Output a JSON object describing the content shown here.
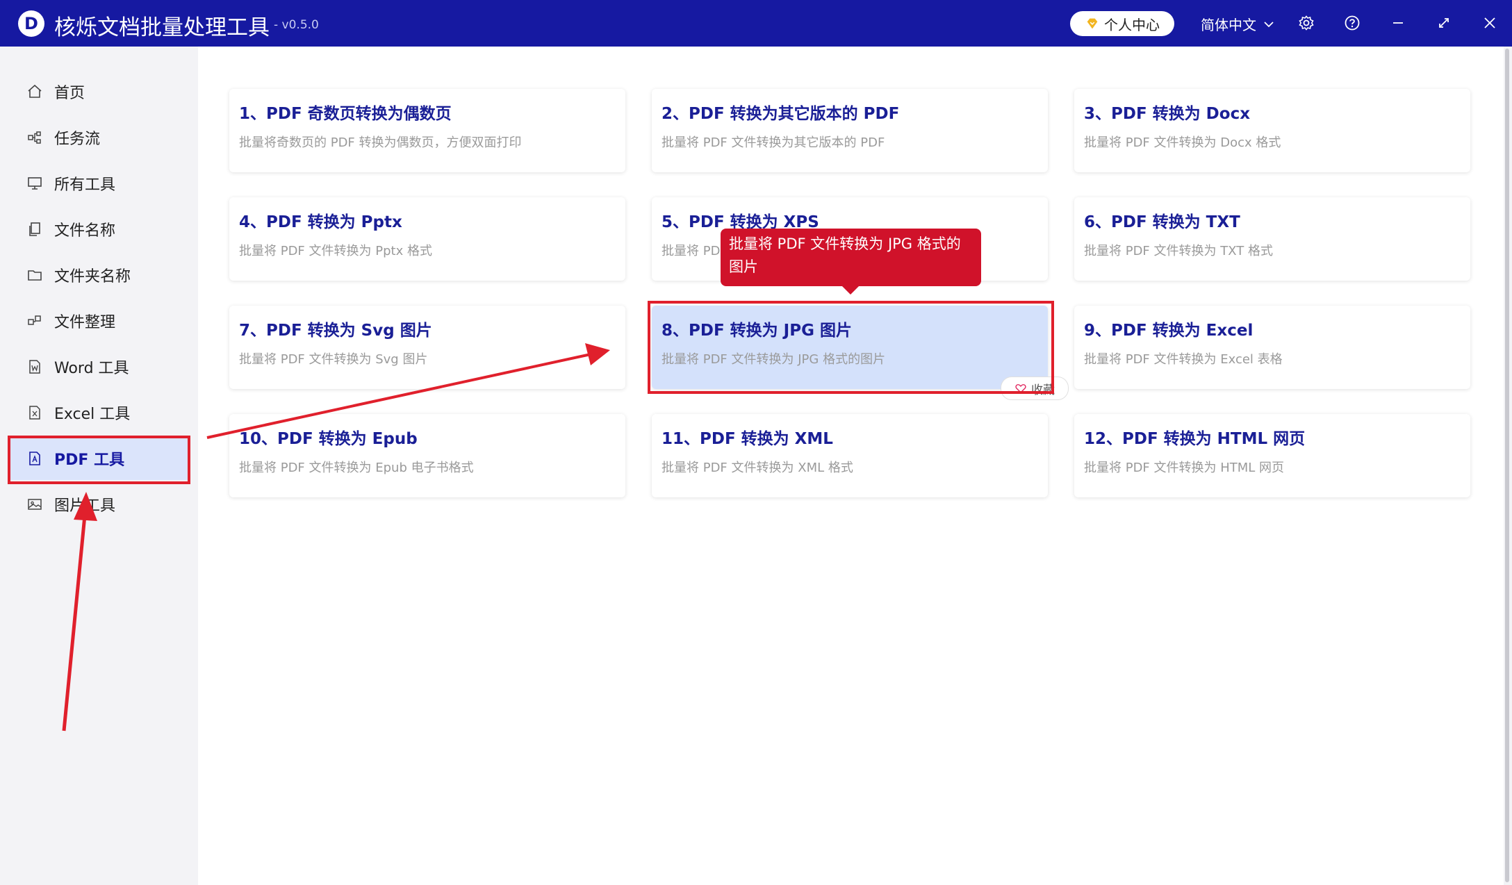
{
  "app": {
    "title": "核烁文档批量处理工具",
    "version": "- v0.5.0",
    "logo_letter": "D",
    "vip_label": "个人中心",
    "language": "简体中文"
  },
  "sidebar": {
    "items": [
      {
        "label": "首页",
        "icon": "home-icon"
      },
      {
        "label": "任务流",
        "icon": "workflow-icon"
      },
      {
        "label": "所有工具",
        "icon": "monitor-icon"
      },
      {
        "label": "文件名称",
        "icon": "file-copy-icon"
      },
      {
        "label": "文件夹名称",
        "icon": "folder-icon"
      },
      {
        "label": "文件整理",
        "icon": "organize-icon"
      },
      {
        "label": "Word 工具",
        "icon": "word-file-icon"
      },
      {
        "label": "Excel 工具",
        "icon": "excel-file-icon"
      },
      {
        "label": "PDF 工具",
        "icon": "pdf-file-icon"
      },
      {
        "label": "图片工具",
        "icon": "image-icon"
      }
    ],
    "active_index": 8
  },
  "tools": [
    {
      "title": "1、PDF 奇数页转换为偶数页",
      "desc": "批量将奇数页的 PDF 转换为偶数页，方便双面打印"
    },
    {
      "title": "2、PDF 转换为其它版本的 PDF",
      "desc": "批量将 PDF 文件转换为其它版本的 PDF"
    },
    {
      "title": "3、PDF 转换为 Docx",
      "desc": "批量将 PDF 文件转换为 Docx 格式"
    },
    {
      "title": "4、PDF 转换为 Pptx",
      "desc": "批量将 PDF 文件转换为 Pptx 格式"
    },
    {
      "title": "5、PDF 转换为 XPS",
      "desc": "批量将 PDF 文件转换为 XPS 格式"
    },
    {
      "title": "6、PDF 转换为 TXT",
      "desc": "批量将 PDF 文件转换为 TXT 格式"
    },
    {
      "title": "7、PDF 转换为 Svg 图片",
      "desc": "批量将 PDF 文件转换为 Svg 图片"
    },
    {
      "title": "8、PDF 转换为 JPG 图片",
      "desc": "批量将 PDF 文件转换为 JPG 格式的图片"
    },
    {
      "title": "9、PDF 转换为 Excel",
      "desc": "批量将 PDF 文件转换为 Excel 表格"
    },
    {
      "title": "10、PDF 转换为 Epub",
      "desc": "批量将 PDF 文件转换为 Epub 电子书格式"
    },
    {
      "title": "11、PDF 转换为 XML",
      "desc": "批量将 PDF 文件转换为 XML 格式"
    },
    {
      "title": "12、PDF 转换为 HTML 网页",
      "desc": "批量将 PDF 文件转换为 HTML 网页"
    }
  ],
  "selected_tool_index": 7,
  "favorite_label": "收藏",
  "tooltip_text": "批量将 PDF 文件转换为 JPG 格式的图片",
  "colors": {
    "titlebar": "#1619a1",
    "accent": "#1a1f96",
    "annotation": "#e0202c",
    "selected_card": "#d4e1fb"
  }
}
